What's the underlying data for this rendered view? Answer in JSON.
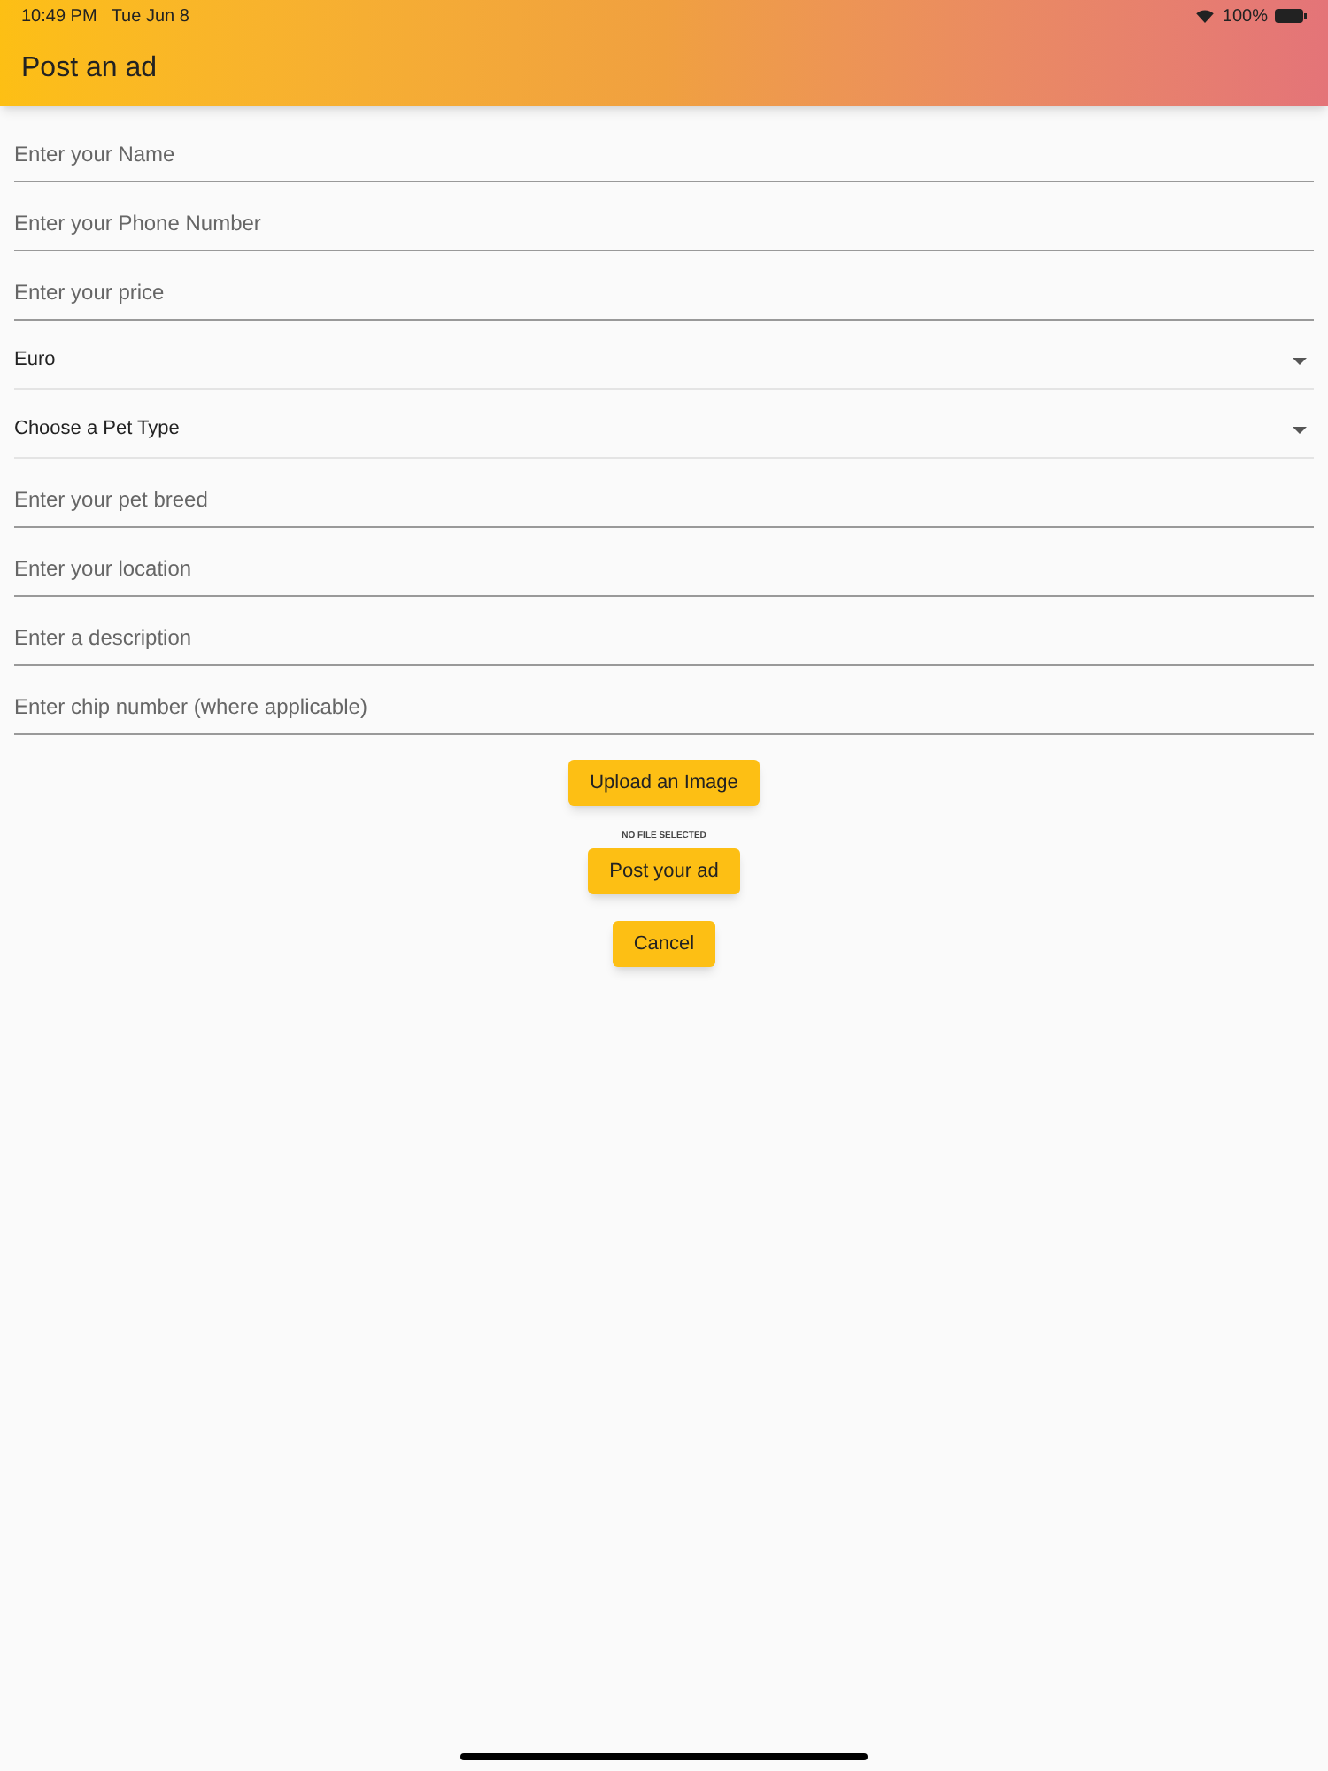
{
  "status_bar": {
    "time": "10:49 PM",
    "date": "Tue Jun 8",
    "battery": "100%"
  },
  "app_bar": {
    "title": "Post an ad"
  },
  "fields": [
    {
      "kind": "text",
      "placeholder": "Enter your Name"
    },
    {
      "kind": "text",
      "placeholder": "Enter your Phone Number"
    },
    {
      "kind": "text",
      "placeholder": "Enter your price"
    },
    {
      "kind": "dropdown",
      "value": "Euro"
    },
    {
      "kind": "dropdown",
      "value": "Choose a Pet Type"
    },
    {
      "kind": "text",
      "placeholder": "Enter your pet breed"
    },
    {
      "kind": "text",
      "placeholder": "Enter your location"
    },
    {
      "kind": "text",
      "placeholder": "Enter a description"
    },
    {
      "kind": "text",
      "placeholder": "Enter chip number (where applicable)"
    }
  ],
  "upload_button": "Upload an Image",
  "file_status": "NO FILE SELECTED",
  "buttons": [
    "Post your ad",
    "Cancel"
  ]
}
